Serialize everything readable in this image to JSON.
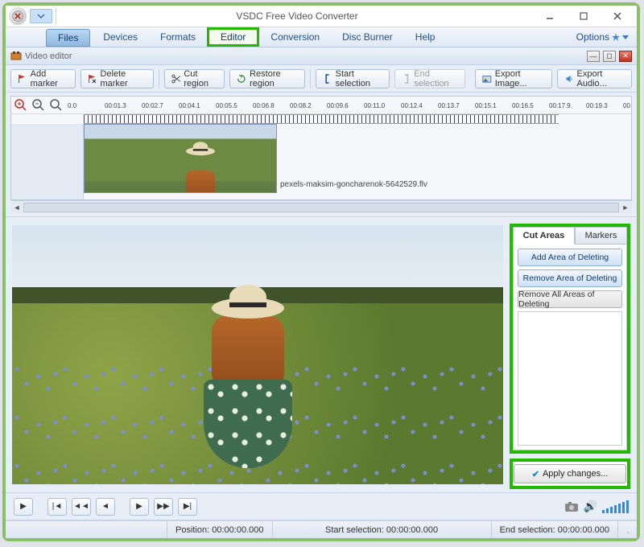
{
  "window": {
    "title": "VSDC Free Video Converter"
  },
  "menu": {
    "files": "Files",
    "devices": "Devices",
    "formats": "Formats",
    "editor": "Editor",
    "conversion": "Conversion",
    "disc_burner": "Disc Burner",
    "help": "Help",
    "options": "Options"
  },
  "sub_header": {
    "title": "Video editor"
  },
  "toolbar": {
    "add_marker": "Add marker",
    "delete_marker": "Delete marker",
    "cut_region": "Cut region",
    "restore_region": "Restore region",
    "start_selection": "Start selection",
    "end_selection": "End selection",
    "export_image": "Export Image...",
    "export_audio": "Export Audio..."
  },
  "timeline": {
    "ticks": [
      "0.0",
      "00:01.3",
      "00:02.7",
      "00:04.1",
      "00:05.5",
      "00:06.8",
      "00:08.2",
      "00:09.6",
      "00:11.0",
      "00:12.4",
      "00:13.7",
      "00:15.1",
      "00:16.5",
      "00:17.9",
      "00:19.3",
      "00"
    ],
    "clip_filename": "pexels-maksim-goncharenok-5642529.flv"
  },
  "side": {
    "tab_cut": "Cut Areas",
    "tab_markers": "Markers",
    "add_area": "Add Area of Deleting",
    "remove_area": "Remove Area of Deleting",
    "remove_all": "Remove All Areas of Deleting"
  },
  "apply": {
    "label": "Apply changes..."
  },
  "status": {
    "position_label": "Position:",
    "position_value": "00:00:00.000",
    "start_label": "Start selection:",
    "start_value": "00:00:00.000",
    "end_label": "End selection:",
    "end_value": "00:00:00.000"
  }
}
